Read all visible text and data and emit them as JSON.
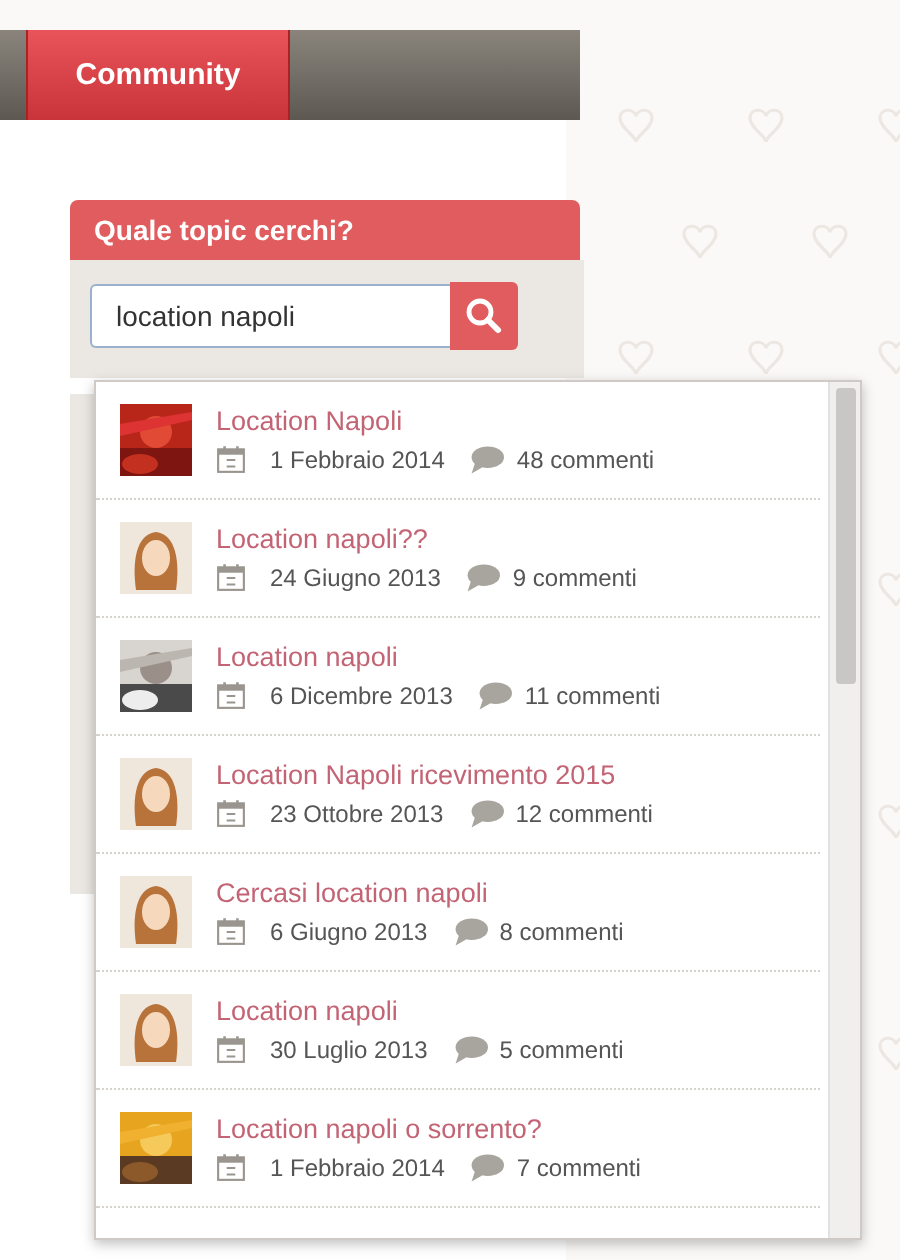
{
  "nav": {
    "tabs": [
      {
        "label": "Community",
        "selected": true
      }
    ]
  },
  "search": {
    "title": "Quale topic cerchi?",
    "value": "location napoli"
  },
  "results": [
    {
      "title": "Location Napoli",
      "date": "1 Febbraio 2014",
      "comments": "48 commenti"
    },
    {
      "avatar": {
        "kind": "illustration"
      },
      "title": "Location napoli??",
      "date": "24 Giugno 2013",
      "comments": "9 commenti"
    },
    {
      "title": "Location napoli",
      "date": "6 Dicembre 2013",
      "comments": "11 commenti"
    },
    {
      "avatar": {
        "kind": "illustration"
      },
      "title": "Location Napoli ricevimento 2015",
      "date": "23 Ottobre 2013",
      "comments": "12 commenti"
    },
    {
      "avatar": {
        "kind": "illustration"
      },
      "title": "Cercasi location napoli",
      "date": "6 Giugno 2013",
      "comments": "8 commenti"
    },
    {
      "avatar": {
        "kind": "illustration"
      },
      "title": "Location napoli",
      "date": "30 Luglio 2013",
      "comments": "5 commenti"
    },
    {
      "title": "Location napoli o sorrento?",
      "date": "1 Febbraio 2014",
      "comments": "7 commenti"
    }
  ]
}
